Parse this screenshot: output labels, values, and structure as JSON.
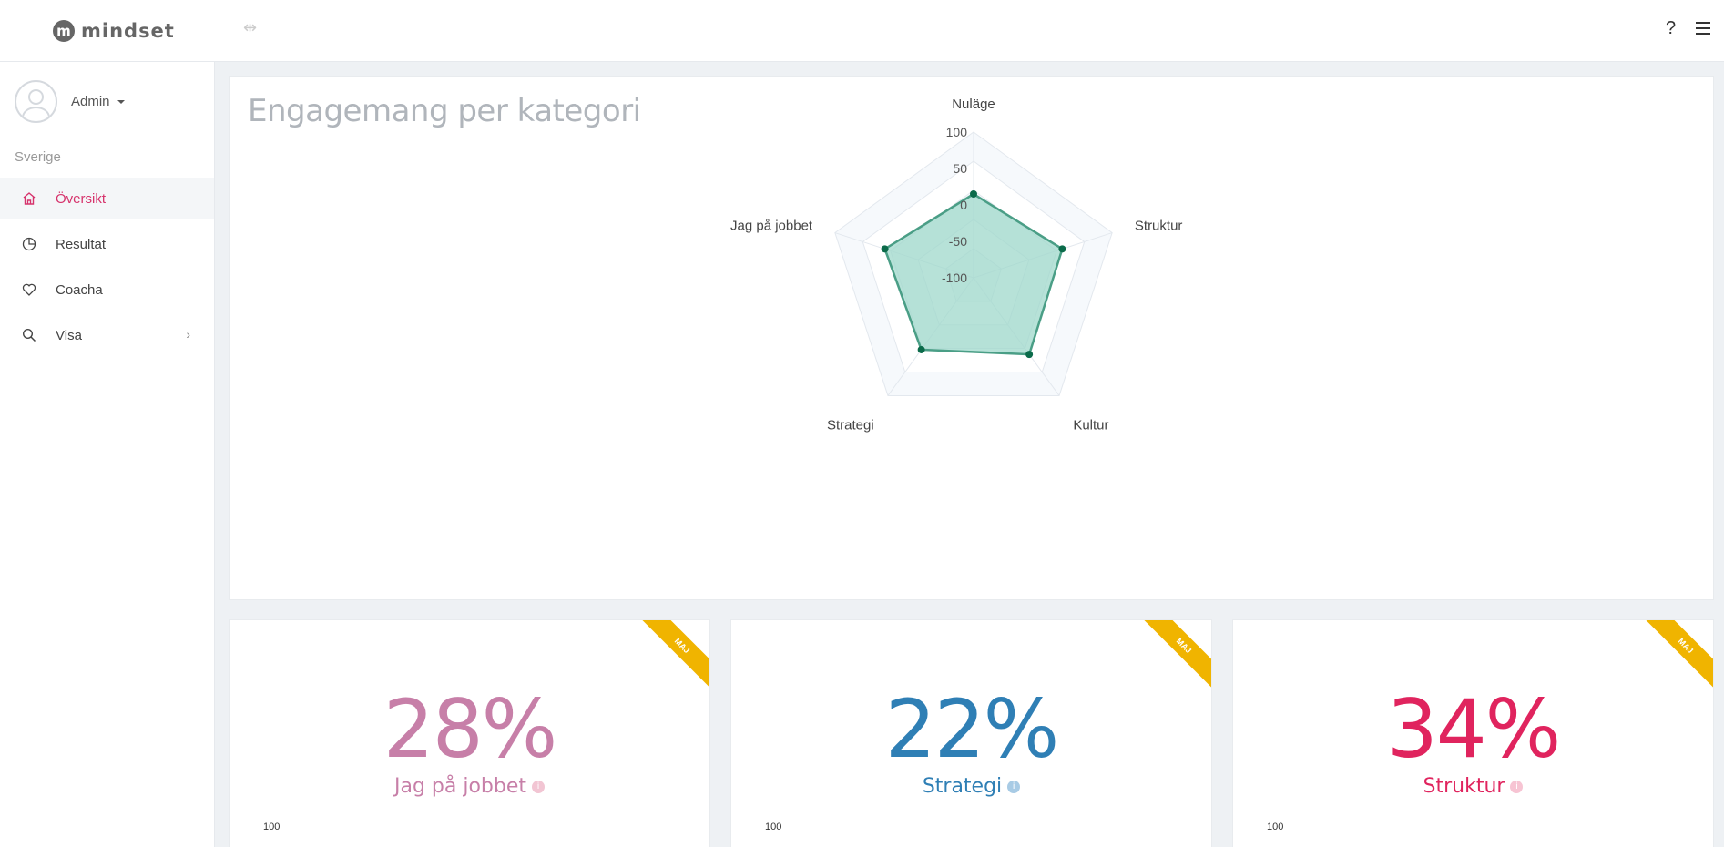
{
  "brand": {
    "logo_letter": "m",
    "name": "mindset"
  },
  "topbar": {
    "help": "?"
  },
  "user": {
    "name": "Admin"
  },
  "region": "Sverige",
  "nav": [
    {
      "label": "Översikt",
      "icon": "home-icon",
      "active": true
    },
    {
      "label": "Resultat",
      "icon": "pie-chart-icon"
    },
    {
      "label": "Coacha",
      "icon": "heart-icon"
    },
    {
      "label": "Visa",
      "icon": "search-icon",
      "chevron": "›"
    }
  ],
  "panel": {
    "title": "Engagemang per kategori"
  },
  "chart_data": {
    "type": "radar",
    "axes": [
      "Nuläge",
      "Struktur",
      "Kultur",
      "Strategi",
      "Jag på jobbet"
    ],
    "ticks": [
      "100",
      "50",
      "0",
      "-50",
      "-100"
    ],
    "ylim": [
      -100,
      100
    ],
    "values": [
      15,
      28,
      30,
      22,
      28
    ],
    "fill_color": "#9fd8cb",
    "line_color": "#4a9e86",
    "point_color": "#0b6b4a"
  },
  "cards": [
    {
      "value": "28%",
      "label": "Jag på jobbet",
      "color": "#c77fa8",
      "info_color": "#f2c5d3",
      "ribbon": "MAJ",
      "axis_top": "100"
    },
    {
      "value": "22%",
      "label": "Strategi",
      "color": "#2f7fb5",
      "info_color": "#a8cbe5",
      "ribbon": "MAJ",
      "axis_top": "100"
    },
    {
      "value": "34%",
      "label": "Struktur",
      "color": "#e0245e",
      "info_color": "#f7c4d3",
      "ribbon": "MAJ",
      "axis_top": "100"
    }
  ]
}
